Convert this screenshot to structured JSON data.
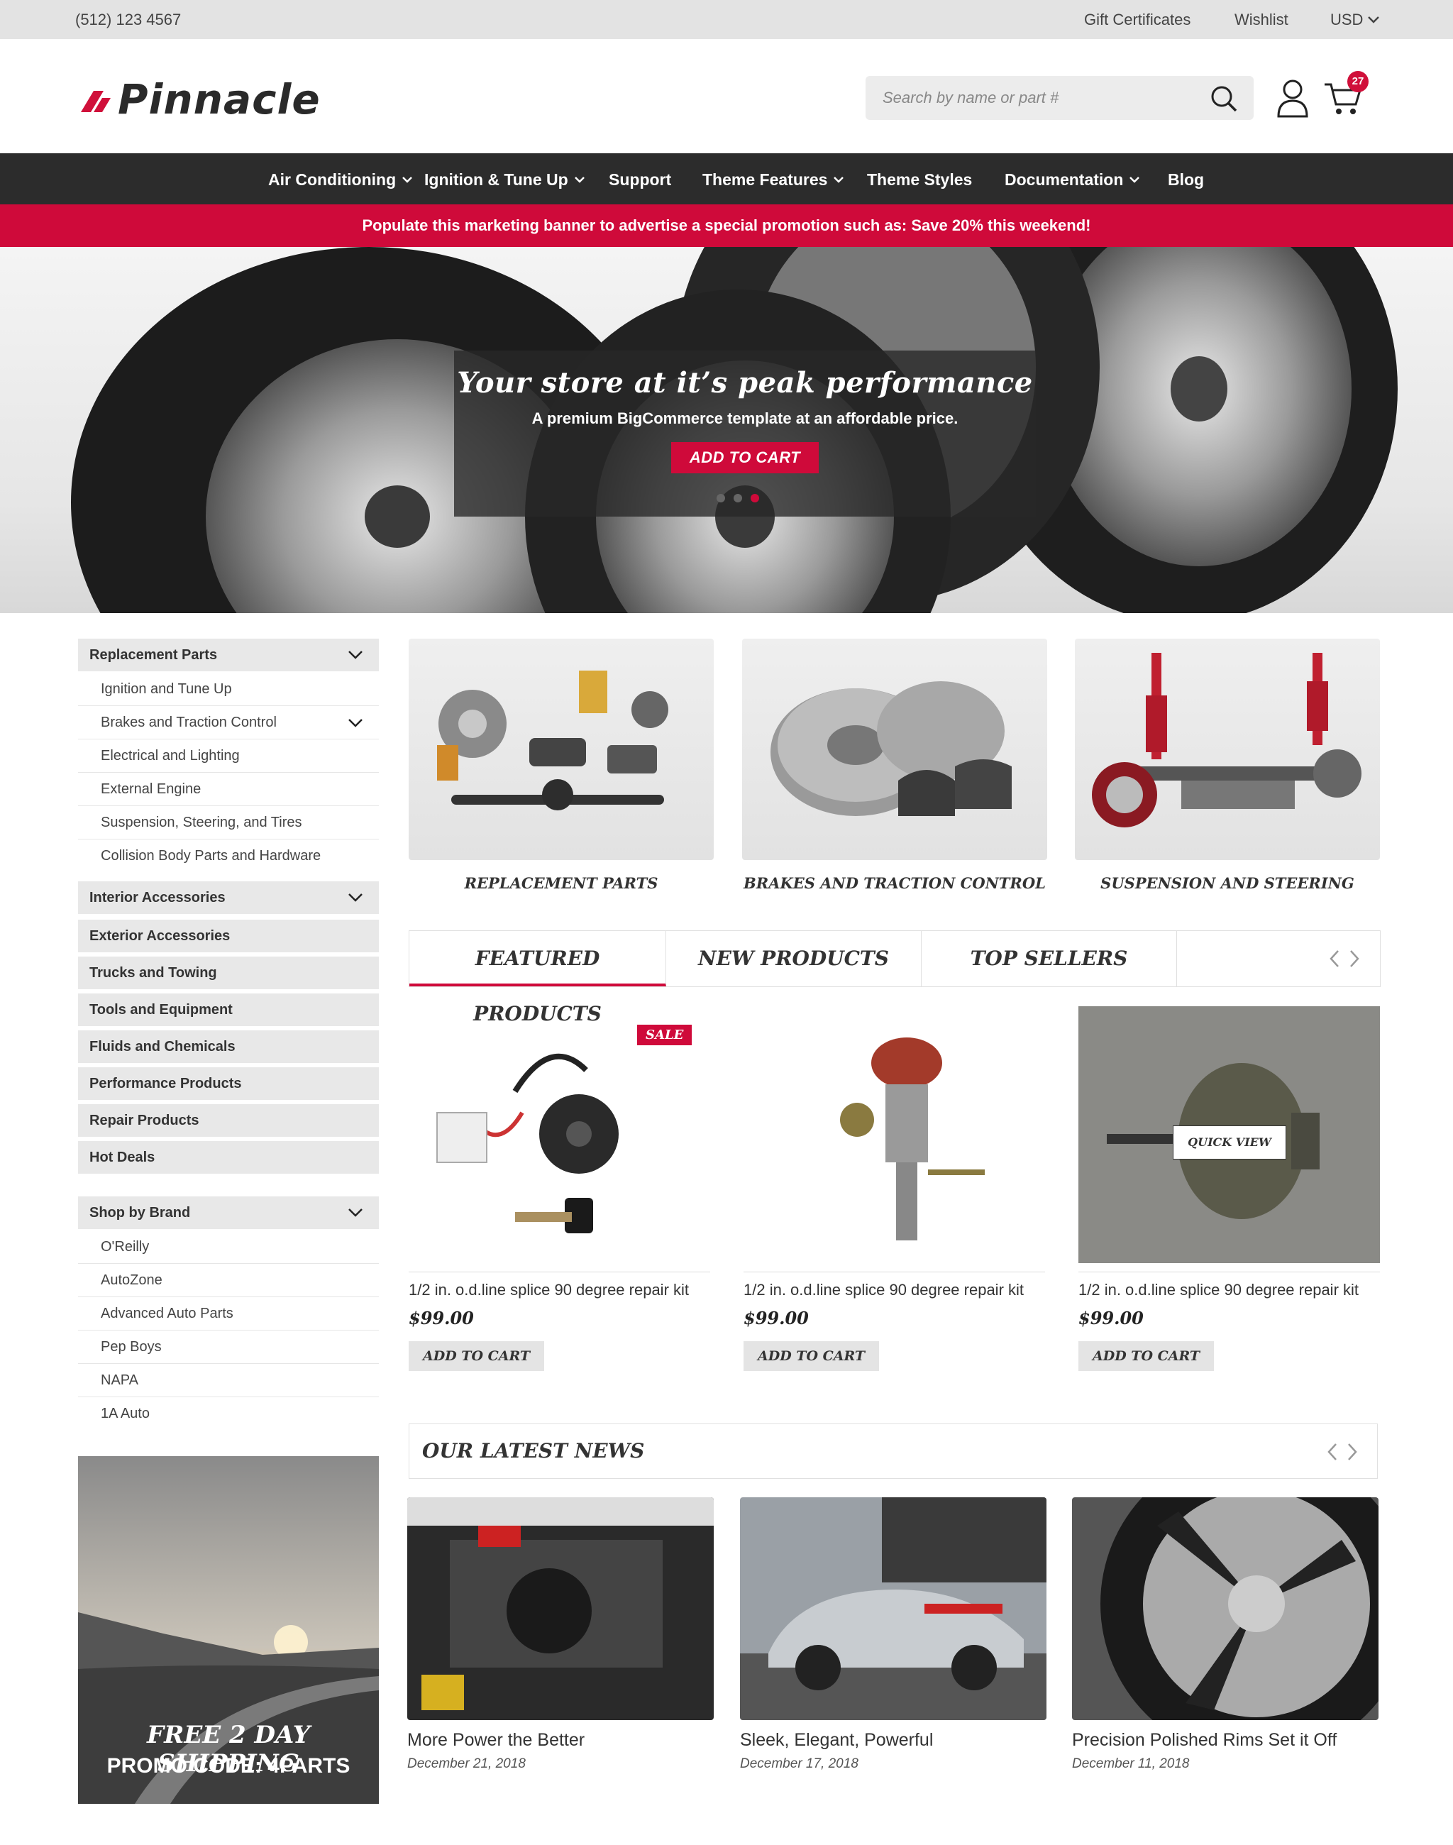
{
  "topbar": {
    "phone": "(512) 123 4567",
    "gift": "Gift Certificates",
    "wishlist": "Wishlist",
    "currency": "USD"
  },
  "header": {
    "logo_text": "Pinnacle",
    "search_placeholder": "Search by name or part #",
    "cart_count": "27"
  },
  "nav": {
    "items": [
      {
        "label": "Air Conditioning"
      },
      {
        "label": "Ignition & Tune Up"
      },
      {
        "label": "Support"
      },
      {
        "label": "Theme Features"
      },
      {
        "label": "Theme Styles"
      },
      {
        "label": "Documentation"
      },
      {
        "label": "Blog"
      }
    ]
  },
  "promo_banner": "Populate this marketing banner to advertise a special promotion such as: Save 20% this weekend!",
  "hero": {
    "title": "Your store at it’s peak performance",
    "subtitle": "A premium BigCommerce template at an affordable price.",
    "button": "ADD TO CART"
  },
  "sidebar": {
    "replacement_header": "Replacement Parts",
    "replacement_items": [
      "Ignition and Tune Up",
      "Brakes and Traction Control",
      "Electrical and Lighting",
      "External Engine",
      "Suspension, Steering, and Tires",
      "Collision Body Parts and Hardware"
    ],
    "interior_header": "Interior Accessories",
    "categories": [
      "Exterior Accessories",
      "Trucks and Towing",
      "Tools and Equipment",
      "Fluids and Chemicals",
      "Performance Products",
      "Repair Products",
      "Hot Deals"
    ],
    "brand_header": "Shop by Brand",
    "brands": [
      "O'Reilly",
      "AutoZone",
      "Advanced Auto Parts",
      "Pep Boys",
      "NAPA",
      "1A Auto"
    ],
    "promo_line1": "FREE 2 DAY SHIPPING",
    "promo_line2": "PROMO CODE: 4PARTS"
  },
  "category_cards": [
    {
      "label": "REPLACEMENT PARTS"
    },
    {
      "label": "BRAKES AND TRACTION CONTROL"
    },
    {
      "label": "SUSPENSION AND STEERING"
    }
  ],
  "tabs": {
    "featured": "FEATURED PRODUCTS",
    "new": "NEW PRODUCTS",
    "top": "TOP SELLERS"
  },
  "products": [
    {
      "title": "1/2 in. o.d.line splice 90 degree repair kit",
      "price": "$99.00",
      "button": "ADD TO CART",
      "badge": "SALE"
    },
    {
      "title": "1/2 in. o.d.line splice 90 degree repair kit",
      "price": "$99.00",
      "button": "ADD TO CART"
    },
    {
      "title": "1/2 in. o.d.line splice 90 degree repair kit",
      "price": "$99.00",
      "button": "ADD TO CART",
      "overlay": "QUICK VIEW"
    }
  ],
  "news": {
    "header": "OUR LATEST NEWS",
    "posts": [
      {
        "title": "More Power the Better",
        "date": "December 21, 2018"
      },
      {
        "title": "Sleek, Elegant, Powerful",
        "date": "December 17, 2018"
      },
      {
        "title": "Precision Polished Rims Set it Off",
        "date": "December 11, 2018"
      }
    ]
  },
  "colors": {
    "accent": "#cf0a3a",
    "nav_bg": "#2c2c2c",
    "topbar_bg": "#e3e3e3"
  }
}
